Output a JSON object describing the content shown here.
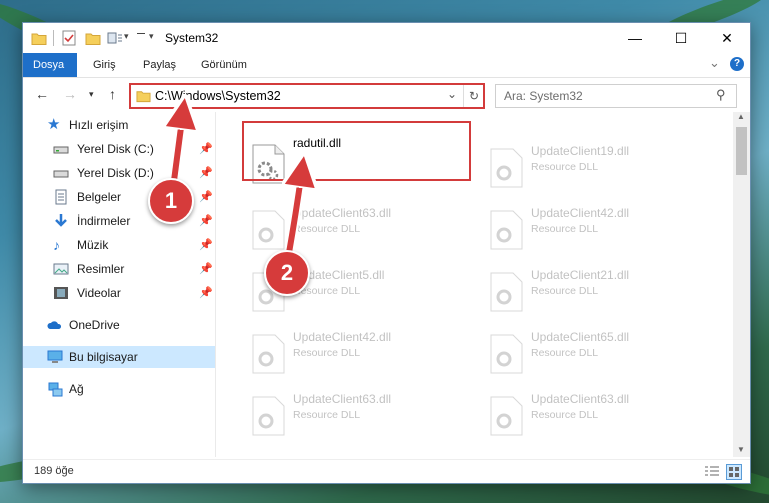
{
  "window": {
    "title": "System32",
    "minimize_glyph": "—",
    "maximize_glyph": "☐",
    "close_glyph": "✕"
  },
  "ribbon": {
    "tabs": [
      "Dosya",
      "Giriş",
      "Paylaş",
      "Görünüm"
    ],
    "collapse_glyph": "⌄",
    "help_glyph": "?"
  },
  "address": {
    "path": "C:\\Windows\\System32",
    "search_placeholder": "Ara: System32"
  },
  "nav": {
    "quick_access": "Hızlı erişim",
    "items": [
      {
        "label": "Yerel Disk (C:)",
        "icon": "drive-icon"
      },
      {
        "label": "Yerel Disk (D:)",
        "icon": "drive-icon"
      },
      {
        "label": "Belgeler",
        "icon": "documents-icon"
      },
      {
        "label": "İndirmeler",
        "icon": "downloads-icon"
      },
      {
        "label": "Müzik",
        "icon": "music-icon"
      },
      {
        "label": "Resimler",
        "icon": "pictures-icon"
      },
      {
        "label": "Videolar",
        "icon": "videos-icon"
      }
    ],
    "onedrive": "OneDrive",
    "this_pc": "Bu bilgisayar",
    "network": "Ağ"
  },
  "files": {
    "highlighted": {
      "name": "radutil.dll",
      "type": ""
    },
    "faded": [
      {
        "name": "UpdateClient19.dll",
        "type": "Resource DLL"
      },
      {
        "name": "UpdateClient63.dll",
        "type": "Resource DLL"
      },
      {
        "name": "UpdateClient42.dll",
        "type": "Resource DLL"
      },
      {
        "name": "UpdateClient5.dll",
        "type": "Resource DLL"
      },
      {
        "name": "UpdateClient21.dll",
        "type": "Resource DLL"
      },
      {
        "name": "UpdateClient42.dll",
        "type": "Resource DLL"
      },
      {
        "name": "UpdateClient65.dll",
        "type": "Resource DLL"
      },
      {
        "name": "UpdateClient63.dll",
        "type": "Resource DLL"
      },
      {
        "name": "UpdateClient63.dll",
        "type": "Resource DLL"
      }
    ]
  },
  "status": {
    "count": "189 öğe"
  },
  "callouts": [
    "1",
    "2"
  ],
  "colors": {
    "accent": "#1e6fc9",
    "highlight": "#d33b3b",
    "selection": "#cce8ff"
  }
}
